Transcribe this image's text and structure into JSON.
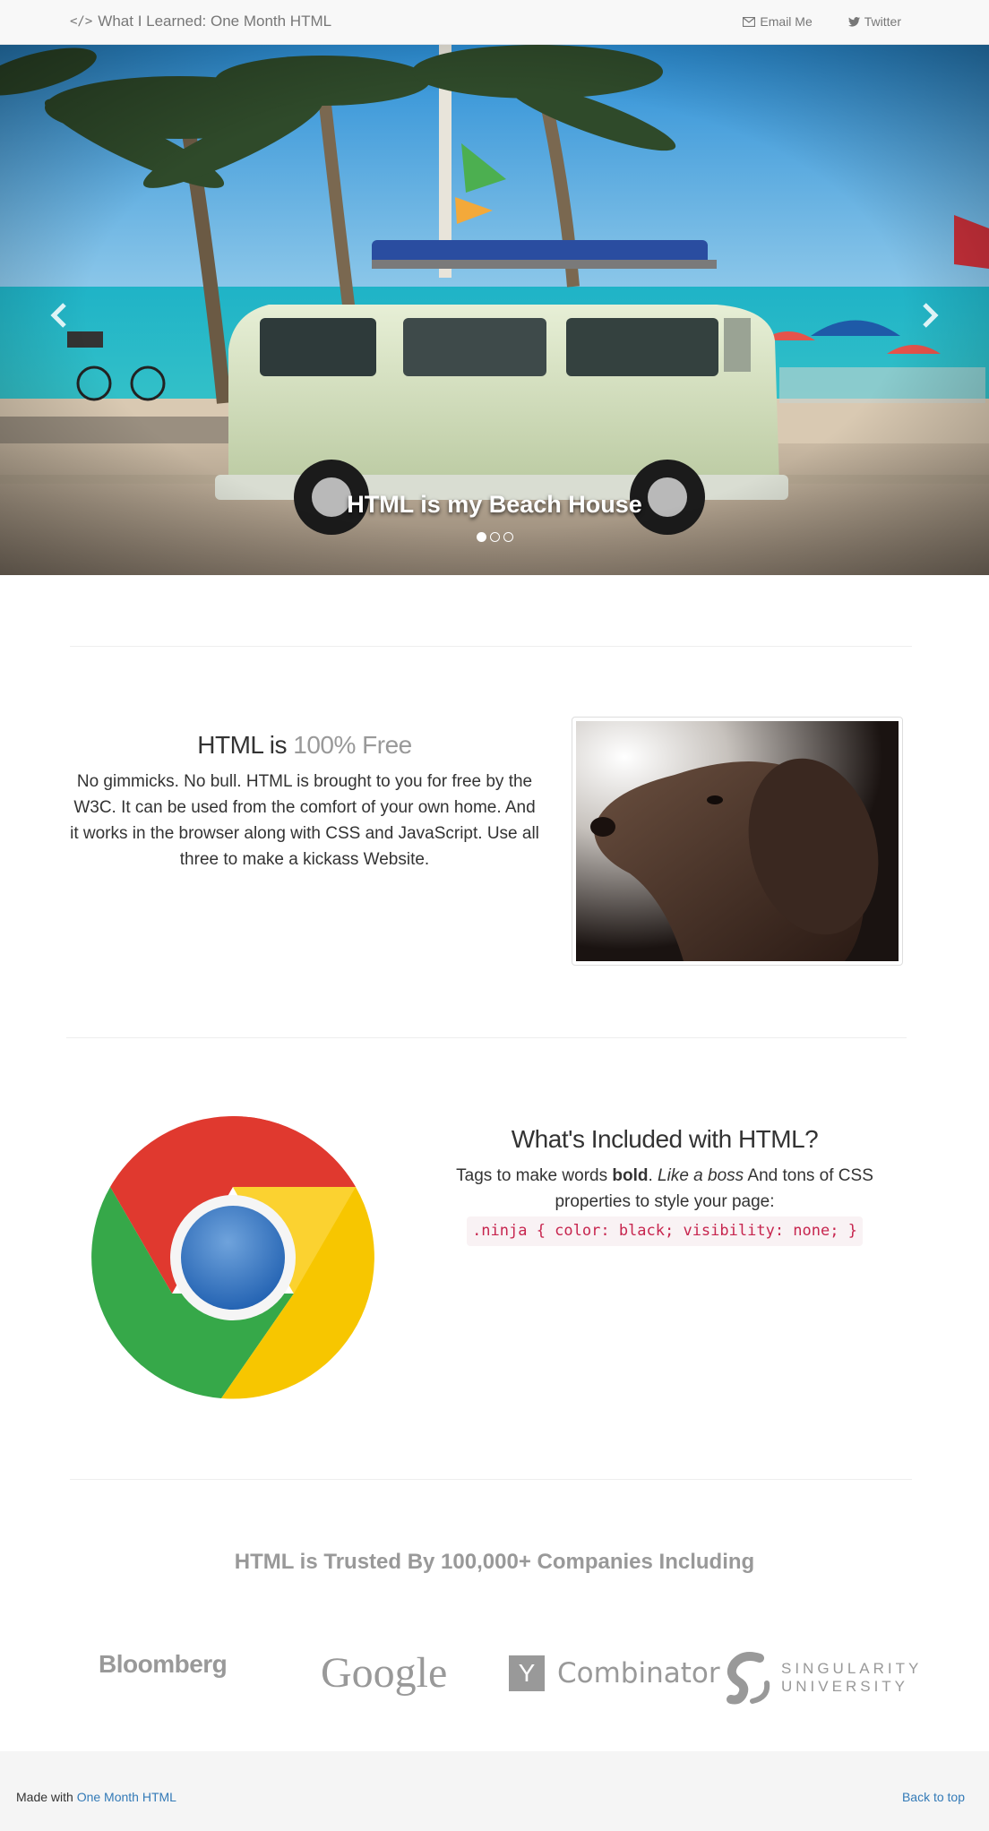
{
  "navbar": {
    "brand": "What I Learned: One Month HTML",
    "links": [
      {
        "label": "Email Me",
        "icon": "envelope-icon"
      },
      {
        "label": "Twitter",
        "icon": "twitter-bird-icon"
      }
    ]
  },
  "carousel": {
    "caption": "HTML is my Beach House",
    "slides": 3,
    "active_slide": 1
  },
  "feature1": {
    "heading_main": "HTML is ",
    "heading_muted": "100% Free",
    "body": "No gimmicks. No bull. HTML is brought to you for free by the W3C. It can be used from the comfort of your own home. And it works in the browser along with CSS and JavaScript. Use all three to make a kickass Website."
  },
  "feature2": {
    "heading": "What's Included with HTML?",
    "text_before_bold": "Tags to make words ",
    "bold": "bold",
    "text_after_bold": ". ",
    "italic": "Like a boss",
    "text_after_italic": " And tons of CSS properties to style your page:",
    "code": ".ninja { color: black; visibility: none; }"
  },
  "trusted": {
    "heading": "HTML is Trusted By 100,000+ Companies Including",
    "logos": {
      "bloomberg": "Bloomberg",
      "google": "Google",
      "yc_letter": "Y",
      "yc": "Combinator",
      "su_line1": "SINGULARITY",
      "su_line2": "UNIVERSITY"
    }
  },
  "footer": {
    "made_with": "Made with ",
    "made_with_link": "One Month HTML",
    "back_to_top": "Back to top"
  },
  "colors": {
    "link": "#337ab7",
    "code": "#c7254e",
    "muted": "#999999"
  }
}
